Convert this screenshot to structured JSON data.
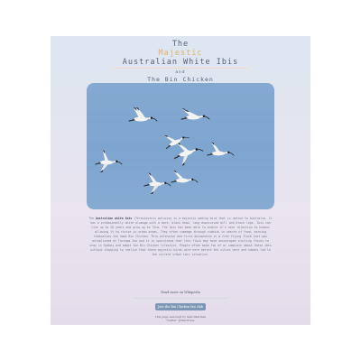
{
  "header": {
    "title_line1": "The",
    "title_accent": "Majestic",
    "title_line2": "Australian White Ibis",
    "and": "and",
    "subtitle": "The Bin Chicken"
  },
  "hero_image": {
    "alt": "Flock of Australian White Ibis in flight",
    "bird_count": 8
  },
  "description": {
    "prefix": "The",
    "species": "Australian white ibis",
    "body": "(Threskiornis molucca) is a majestic wading bird that is native to Australia. It has a predominantly white plumage with a bare, black head, long downcurved bill and black legs. Ibis can live up to 28 years and grow up to 75cm. The ibis has been able to endure it's near rejection to humans allowing it to thrive in urban areas. They often rummage through rubbish in search of food, earning themselves the name Bin Chicken. This extensive and first documented in a free flying flock that was established at Taronga Zoo and it is speculated that this flock may have encouraged trailing flocks to stay in Sydney and adopt the Bin Chicken lifestyle. People often make fun of or complain about these ibis without stopping to realise that these majestic birds were here before the cities were and humans led to the current urban ibis situation."
  },
  "read_more": {
    "text": "Read more on Wikipedia"
  },
  "cta": {
    "label": "Join the Bin Chicken fan club"
  },
  "footer": {
    "line1": "This page was built by Sam Sherman",
    "line2": "Twitter: @bincircles"
  },
  "colors": {
    "accent": "#e0b46a",
    "heading": "#55617a",
    "button": "#7f97b6",
    "sky": "#7ea5cf"
  }
}
